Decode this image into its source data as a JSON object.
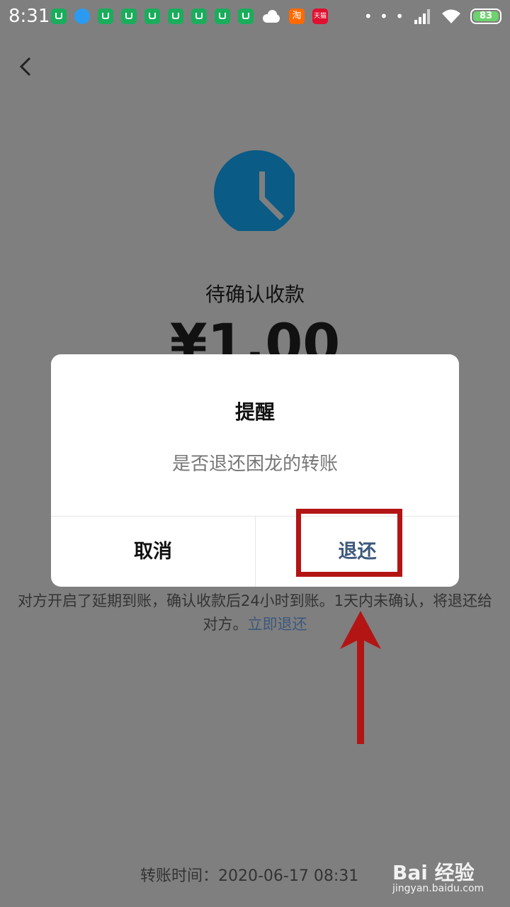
{
  "status_bar": {
    "time": "8:31",
    "battery": "83",
    "icons": [
      "wechat-icon",
      "browser-icon",
      "wechat-icon",
      "wechat-icon",
      "wechat-icon",
      "wechat-icon",
      "wechat-icon",
      "wechat-icon",
      "wechat-icon",
      "cloud-icon",
      "taobao-icon",
      "tmall-icon"
    ],
    "taobao_label": "淘",
    "tmall_label": "天猫",
    "more_dots": "• • •"
  },
  "page": {
    "status": "待确认收款",
    "amount": "¥1.00",
    "info_text": "对方开启了延期到账，确认收款后24小时到账。1天内未确认，将退还给对方。",
    "info_link": "立即退还",
    "transfer_time": "转账时间：2020-06-17 08:31"
  },
  "dialog": {
    "title": "提醒",
    "message": "是否退还困龙的转账",
    "cancel_label": "取消",
    "return_label": "退还"
  },
  "watermark": {
    "main": "Bai 经验",
    "sub": "jingyan.baidu.com"
  },
  "colors": {
    "overlay": "#7f7f7f",
    "clock": "#0a5b85",
    "link": "#3c587c",
    "annotation": "#b31515"
  }
}
